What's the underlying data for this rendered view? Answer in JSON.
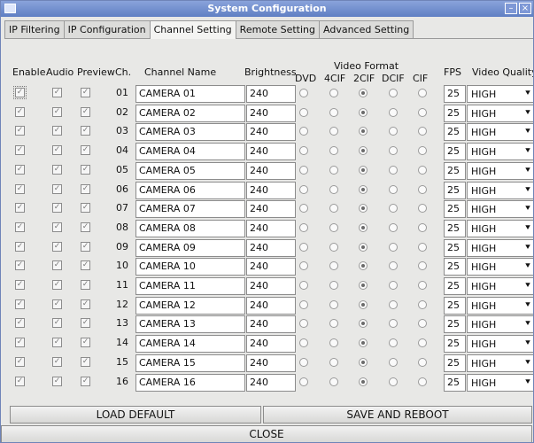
{
  "window": {
    "title": "System Configuration"
  },
  "tabs": [
    "IP Filtering",
    "IP Configuration",
    "Channel Setting",
    "Remote Setting",
    "Advanced Setting"
  ],
  "headers": {
    "enable": "Enable",
    "audio": "Audio",
    "preview": "Preview",
    "ch": "Ch.",
    "channel_name": "Channel Name",
    "brightness": "Brightness",
    "video_format": "Video Format",
    "dvd": "DVD",
    "4cif": "4CIF",
    "2cif": "2CIF",
    "dcif": "DCIF",
    "cif": "CIF",
    "fps": "FPS",
    "video_quality": "Video Quality"
  },
  "channels": [
    {
      "ch": "01",
      "name": "CAMERA 01",
      "brightness": "240",
      "fps": "25",
      "quality": "HIGH"
    },
    {
      "ch": "02",
      "name": "CAMERA 02",
      "brightness": "240",
      "fps": "25",
      "quality": "HIGH"
    },
    {
      "ch": "03",
      "name": "CAMERA 03",
      "brightness": "240",
      "fps": "25",
      "quality": "HIGH"
    },
    {
      "ch": "04",
      "name": "CAMERA 04",
      "brightness": "240",
      "fps": "25",
      "quality": "HIGH"
    },
    {
      "ch": "05",
      "name": "CAMERA 05",
      "brightness": "240",
      "fps": "25",
      "quality": "HIGH"
    },
    {
      "ch": "06",
      "name": "CAMERA 06",
      "brightness": "240",
      "fps": "25",
      "quality": "HIGH"
    },
    {
      "ch": "07",
      "name": "CAMERA 07",
      "brightness": "240",
      "fps": "25",
      "quality": "HIGH"
    },
    {
      "ch": "08",
      "name": "CAMERA 08",
      "brightness": "240",
      "fps": "25",
      "quality": "HIGH"
    },
    {
      "ch": "09",
      "name": "CAMERA 09",
      "brightness": "240",
      "fps": "25",
      "quality": "HIGH"
    },
    {
      "ch": "10",
      "name": "CAMERA 10",
      "brightness": "240",
      "fps": "25",
      "quality": "HIGH"
    },
    {
      "ch": "11",
      "name": "CAMERA 11",
      "brightness": "240",
      "fps": "25",
      "quality": "HIGH"
    },
    {
      "ch": "12",
      "name": "CAMERA 12",
      "brightness": "240",
      "fps": "25",
      "quality": "HIGH"
    },
    {
      "ch": "13",
      "name": "CAMERA 13",
      "brightness": "240",
      "fps": "25",
      "quality": "HIGH"
    },
    {
      "ch": "14",
      "name": "CAMERA 14",
      "brightness": "240",
      "fps": "25",
      "quality": "HIGH"
    },
    {
      "ch": "15",
      "name": "CAMERA 15",
      "brightness": "240",
      "fps": "25",
      "quality": "HIGH"
    },
    {
      "ch": "16",
      "name": "CAMERA 16",
      "brightness": "240",
      "fps": "25",
      "quality": "HIGH"
    }
  ],
  "selected_format": "2CIF",
  "buttons": {
    "load_default": "LOAD DEFAULT",
    "save_reboot": "SAVE AND REBOOT",
    "close": "CLOSE"
  },
  "icons": {
    "checkbox_mark": "✓",
    "dropdown": "⯆",
    "minimize": "–",
    "close": "×"
  }
}
